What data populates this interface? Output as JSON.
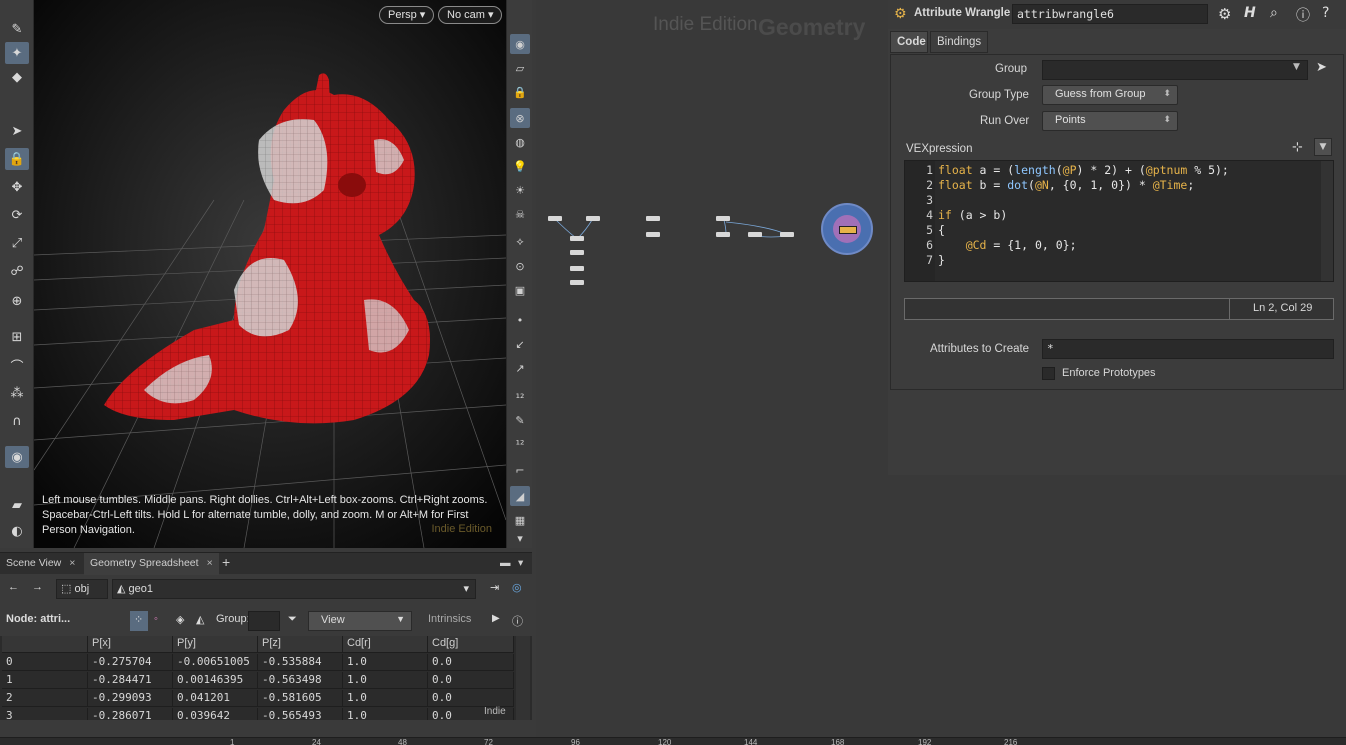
{
  "viewport": {
    "persp_label": "Persp",
    "cam_label": "No cam",
    "help_text": "Left mouse tumbles. Middle pans. Right dollies. Ctrl+Alt+Left box-zooms. Ctrl+Right zooms. Spacebar-Ctrl-Left tilts. Hold L for alternate tumble, dolly, and zoom.     M or Alt+M for First Person Navigation.",
    "watermark": "Indie Edition"
  },
  "tabs": {
    "scene_view": "Scene View",
    "geometry_spreadsheet": "Geometry Spreadsheet",
    "add": "+"
  },
  "path": {
    "obj": "obj",
    "geo": "geo1"
  },
  "spreadsheet": {
    "node_label": "Node: attri...",
    "group_label": "Group:",
    "view_label": "View",
    "intrinsics_label": "Intrinsics",
    "columns": [
      "",
      "P[x]",
      "P[y]",
      "P[z]",
      "Cd[r]",
      "Cd[g]"
    ],
    "rows": [
      [
        "0",
        "-0.275704",
        "-0.00651005",
        "-0.535884",
        "1.0",
        "0.0"
      ],
      [
        "1",
        "-0.284471",
        "0.00146395",
        "-0.563498",
        "1.0",
        "0.0"
      ],
      [
        "2",
        "-0.299093",
        "0.041201",
        "-0.581605",
        "1.0",
        "0.0"
      ],
      [
        "3",
        "-0.286071",
        "0.039642",
        "-0.565493",
        "1.0",
        "0.0"
      ]
    ],
    "watermark": "Indie"
  },
  "network": {
    "watermark": "Indie Edition",
    "title": "Geometry"
  },
  "params": {
    "node_type": "Attribute Wrangle",
    "node_name": "attribwrangle6",
    "tab_code": "Code",
    "tab_bindings": "Bindings",
    "group_label": "Group",
    "group_value": "",
    "group_type_label": "Group Type",
    "group_type_value": "Guess from Group",
    "run_over_label": "Run Over",
    "run_over_value": "Points",
    "vex_label": "VEXpression",
    "status": "Ln 2, Col 29",
    "attrs_label": "Attributes to Create",
    "attrs_value": "*",
    "enforce_label": "Enforce Prototypes",
    "code_lines": [
      {
        "n": "1",
        "t": "float a = (length(@P) * 2) + (@ptnum % 5);"
      },
      {
        "n": "2",
        "t": "float b = dot(@N, {0, 1, 0}) * @Time;"
      },
      {
        "n": "3",
        "t": ""
      },
      {
        "n": "4",
        "t": "if (a > b)"
      },
      {
        "n": "5",
        "t": "{"
      },
      {
        "n": "6",
        "t": "    @Cd = {1, 0, 0};"
      },
      {
        "n": "7",
        "t": "}"
      }
    ]
  },
  "timeline": {
    "ticks": [
      "1",
      "24",
      "48",
      "72",
      "96",
      "120",
      "144",
      "168",
      "192",
      "216"
    ]
  },
  "colors": {
    "accent": "#5a6c80",
    "mesh_red": "#c8181a",
    "mesh_white": "#cfcfcf"
  }
}
